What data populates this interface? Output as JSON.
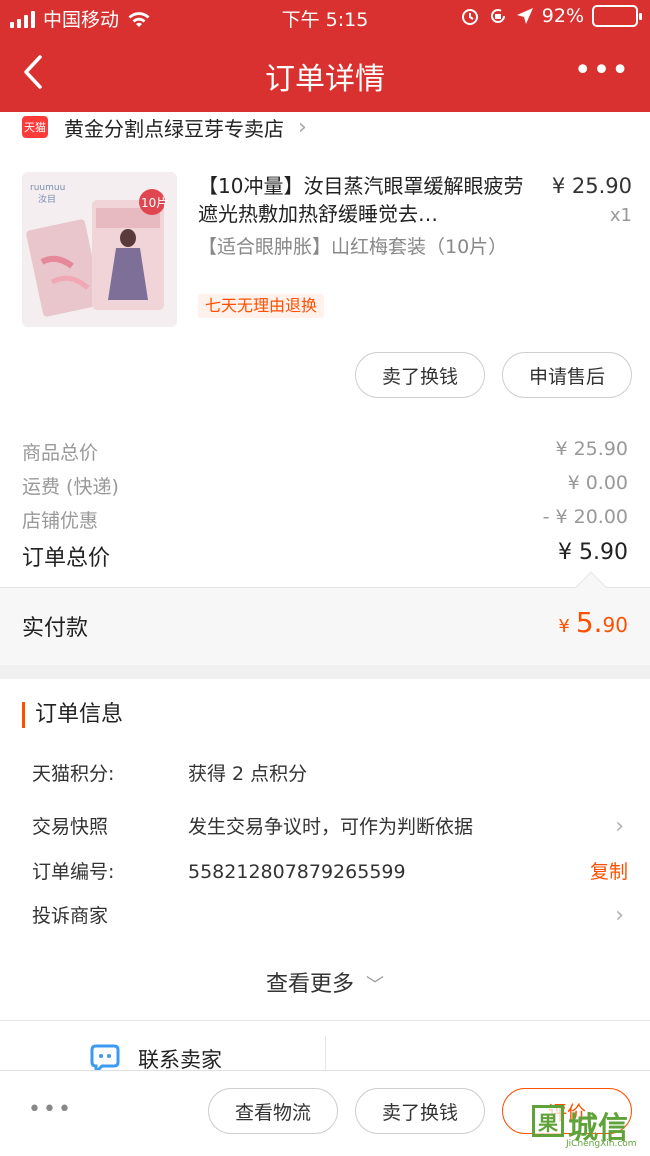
{
  "status": {
    "carrier": "中国移动",
    "time": "下午 5:15",
    "battery": "92%",
    "battery_level": 0.92
  },
  "nav": {
    "title": "订单详情",
    "more": "•••"
  },
  "shop": {
    "badge": "天猫",
    "name": "黄金分割点绿豆芽专卖店"
  },
  "product": {
    "image_brand": "ruumuu 汝目",
    "image_tag": "10片",
    "title": "【10冲量】汝目蒸汽眼罩缓解眼疲劳遮光热敷加热舒缓睡觉去…",
    "sku": "【适合眼肿胀】山红梅套装（10片）",
    "refund_tag": "七天无理由退换",
    "price": "¥ 25.90",
    "qty": "x1"
  },
  "product_actions": {
    "sell": "卖了换钱",
    "after_sale": "申请售后"
  },
  "fees": [
    {
      "label": "商品总价",
      "value": "¥ 25.90"
    },
    {
      "label": "运费 (快递)",
      "value": "¥ 0.00"
    },
    {
      "label": "店铺优惠",
      "value": "- ¥ 20.00"
    }
  ],
  "order_total": {
    "label": "订单总价",
    "value": "¥ 5.90"
  },
  "paid": {
    "label": "实付款",
    "currency": "¥",
    "int": "5.",
    "dec": "90"
  },
  "order_info": {
    "title": "订单信息",
    "rows": [
      {
        "key": "天猫积分:",
        "value": "获得 2 点积分"
      },
      {
        "key": "交易快照",
        "value": "发生交易争议时，可作为判断依据"
      },
      {
        "key": "订单编号:",
        "value": "558212807879265599",
        "action": "复制"
      },
      {
        "key": "投诉商家",
        "value": ""
      }
    ],
    "see_more": "查看更多"
  },
  "contact": {
    "label": "联系卖家"
  },
  "bottom": {
    "more": "•••",
    "logistics": "查看物流",
    "sell": "卖了换钱",
    "review": "评价"
  },
  "watermark": {
    "box": "果",
    "big": "城信",
    "small": "JiChengXin.com"
  },
  "colors": {
    "brand_red": "#d8312f",
    "accent_orange": "#ff5000"
  }
}
